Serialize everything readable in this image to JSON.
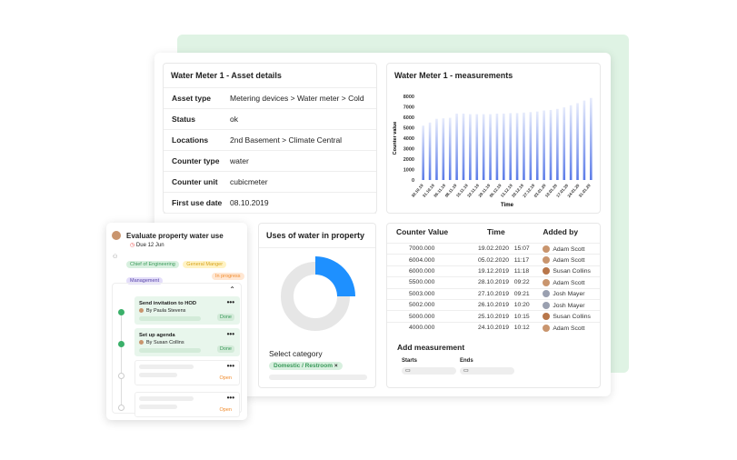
{
  "asset": {
    "title": "Water Meter 1 - Asset details",
    "rows": [
      {
        "k": "Asset type",
        "v": "Metering devices > Water meter > Cold"
      },
      {
        "k": "Status",
        "v": "ok"
      },
      {
        "k": "Locations",
        "v": "2nd Basement > Climate Central"
      },
      {
        "k": "Counter type",
        "v": "water"
      },
      {
        "k": "Counter unit",
        "v": "cubicmeter"
      },
      {
        "k": "First use date",
        "v": "08.10.2019"
      }
    ]
  },
  "chart_data": {
    "type": "bar",
    "title": "Water Meter 1 - measurements",
    "xlabel": "Time",
    "ylabel": "Counter value",
    "ylim": [
      0,
      8000
    ],
    "yticks": [
      0,
      1000,
      2000,
      3000,
      4000,
      5000,
      6000,
      7000,
      8000
    ],
    "xticks": [
      "30.10.19",
      "31.10.19",
      "06.11.19",
      "08.11.19",
      "15.11.19",
      "22.11.19",
      "29.11.19",
      "06.12.19",
      "13.12.19",
      "20.12.19",
      "27.12.19",
      "03.01.20",
      "10.01.20",
      "17.01.20",
      "24.01.20",
      "31.01.20"
    ],
    "values": [
      5200,
      5500,
      5850,
      5900,
      5950,
      6350,
      6350,
      6300,
      6300,
      6300,
      6300,
      6350,
      6350,
      6400,
      6400,
      6450,
      6500,
      6550,
      6650,
      6700,
      6800,
      6950,
      7150,
      7350,
      7600,
      7850
    ],
    "color": "#5b7be8"
  },
  "uses": {
    "title": "Uses of water in property",
    "select_label": "Select category",
    "chip": "Domestic / Restroom",
    "chip_close": "×",
    "fraction": 0.25,
    "color": "#1e90ff"
  },
  "measurements": {
    "headers": [
      "Counter Value",
      "Time",
      "Added by"
    ],
    "rows": [
      [
        "7000.000",
        "19.02.2020",
        "15:07",
        "Adam Scott"
      ],
      [
        "6004.000",
        "05.02.2020",
        "11:17",
        "Adam Scott"
      ],
      [
        "6000.000",
        "19.12.2019",
        "11:18",
        "Susan Collins"
      ],
      [
        "5500.000",
        "28.10.2019",
        "09:22",
        "Adam Scott"
      ],
      [
        "5003.000",
        "27.10.2019",
        "09:21",
        "Josh Mayer"
      ],
      [
        "5002.000",
        "26.10.2019",
        "10:20",
        "Josh Mayer"
      ],
      [
        "5000.000",
        "25.10.2019",
        "10:15",
        "Susan Collins"
      ],
      [
        "4000.000",
        "24.10.2019",
        "10:12",
        "Adam Scott"
      ]
    ],
    "add_title": "Add measurement",
    "starts": "Starts",
    "ends": "Ends"
  },
  "task": {
    "title": "Evaluate property water use",
    "due": "Due 12 Jun",
    "tags": [
      "Chief of Engineering",
      "General Manger",
      "Management"
    ],
    "status": "In progress",
    "steps": [
      {
        "title": "Send invitation to HOD",
        "by": "By Paula Stevens",
        "status": "Done"
      },
      {
        "title": "Set up agenda",
        "by": "By Susan Collins",
        "status": "Done"
      },
      {
        "status": "Open"
      },
      {
        "status": "Open"
      }
    ],
    "more": "•••"
  }
}
